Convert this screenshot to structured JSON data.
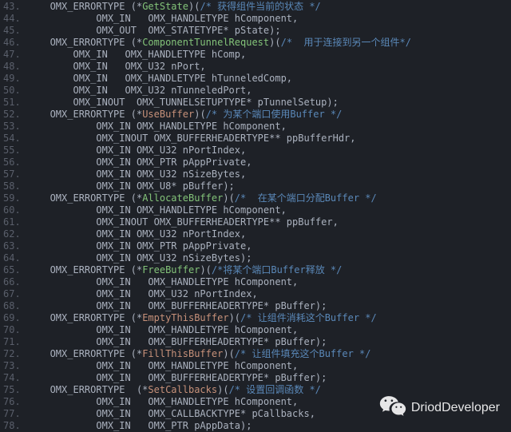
{
  "first_line_no": 43,
  "watermark": "DriodDeveloper",
  "lines": [
    [
      [
        "t",
        "    OMX_ERRORTYPE (*"
      ],
      [
        "fn",
        "GetState"
      ],
      [
        "t",
        ")("
      ],
      [
        "cm",
        "/* 获得组件当前的状态 */"
      ]
    ],
    [
      [
        "t",
        "            OMX_IN   OMX_HANDLETYPE hComponent,"
      ]
    ],
    [
      [
        "t",
        "            OMX_OUT  OMX_STATETYPE* pState);"
      ]
    ],
    [
      [
        "t",
        "    OMX_ERRORTYPE (*"
      ],
      [
        "fn",
        "ComponentTunnelRequest"
      ],
      [
        "t",
        ")("
      ],
      [
        "cm",
        "/*  用于连接到另一个组件*/"
      ]
    ],
    [
      [
        "t",
        "        OMX_IN   OMX_HANDLETYPE hComp,"
      ]
    ],
    [
      [
        "t",
        "        OMX_IN   OMX_U32 nPort,"
      ]
    ],
    [
      [
        "t",
        "        OMX_IN   OMX_HANDLETYPE hTunneledComp,"
      ]
    ],
    [
      [
        "t",
        "        OMX_IN   OMX_U32 nTunneledPort,"
      ]
    ],
    [
      [
        "t",
        "        OMX_INOUT  OMX_TUNNELSETUPTYPE* pTunnelSetup);"
      ]
    ],
    [
      [
        "t",
        "    OMX_ERRORTYPE (*"
      ],
      [
        "fn2",
        "UseBuffer"
      ],
      [
        "t",
        ")("
      ],
      [
        "cm",
        "/* 为某个端口使用Buffer */"
      ]
    ],
    [
      [
        "t",
        "            OMX_IN OMX_HANDLETYPE hComponent,"
      ]
    ],
    [
      [
        "t",
        "            OMX_INOUT OMX_BUFFERHEADERTYPE** ppBufferHdr,"
      ]
    ],
    [
      [
        "t",
        "            OMX_IN OMX_U32 nPortIndex,"
      ]
    ],
    [
      [
        "t",
        "            OMX_IN OMX_PTR pAppPrivate,"
      ]
    ],
    [
      [
        "t",
        "            OMX_IN OMX_U32 nSizeBytes,"
      ]
    ],
    [
      [
        "t",
        "            OMX_IN OMX_U8* pBuffer);"
      ]
    ],
    [
      [
        "t",
        "    OMX_ERRORTYPE (*"
      ],
      [
        "fn",
        "AllocateBuffer"
      ],
      [
        "t",
        ")("
      ],
      [
        "cm",
        "/*  在某个端口分配Buffer */"
      ]
    ],
    [
      [
        "t",
        "            OMX_IN OMX_HANDLETYPE hComponent,"
      ]
    ],
    [
      [
        "t",
        "            OMX_INOUT OMX_BUFFERHEADERTYPE** ppBuffer,"
      ]
    ],
    [
      [
        "t",
        "            OMX_IN OMX_U32 nPortIndex,"
      ]
    ],
    [
      [
        "t",
        "            OMX_IN OMX_PTR pAppPrivate,"
      ]
    ],
    [
      [
        "t",
        "            OMX_IN OMX_U32 nSizeBytes);"
      ]
    ],
    [
      [
        "t",
        "    OMX_ERRORTYPE (*"
      ],
      [
        "fn",
        "FreeBuffer"
      ],
      [
        "t",
        ")("
      ],
      [
        "cm",
        "/*将某个端口Buffer释放 */"
      ]
    ],
    [
      [
        "t",
        "            OMX_IN   OMX_HANDLETYPE hComponent,"
      ]
    ],
    [
      [
        "t",
        "            OMX_IN   OMX_U32 nPortIndex,"
      ]
    ],
    [
      [
        "t",
        "            OMX_IN   OMX_BUFFERHEADERTYPE* pBuffer);"
      ]
    ],
    [
      [
        "t",
        "    OMX_ERRORTYPE (*"
      ],
      [
        "fn2",
        "EmptyThisBuffer"
      ],
      [
        "t",
        ")("
      ],
      [
        "cm",
        "/* 让组件消耗这个Buffer */"
      ]
    ],
    [
      [
        "t",
        "            OMX_IN   OMX_HANDLETYPE hComponent,"
      ]
    ],
    [
      [
        "t",
        "            OMX_IN   OMX_BUFFERHEADERTYPE* pBuffer);"
      ]
    ],
    [
      [
        "t",
        "    OMX_ERRORTYPE (*"
      ],
      [
        "fn2",
        "FillThisBuffer"
      ],
      [
        "t",
        ")("
      ],
      [
        "cm",
        "/* 让组件填充这个Buffer */"
      ]
    ],
    [
      [
        "t",
        "            OMX_IN   OMX_HANDLETYPE hComponent,"
      ]
    ],
    [
      [
        "t",
        "            OMX_IN   OMX_BUFFERHEADERTYPE* pBuffer);"
      ]
    ],
    [
      [
        "t",
        "    OMX_ERRORTYPE  (*"
      ],
      [
        "fn2",
        "SetCallbacks"
      ],
      [
        "t",
        ")("
      ],
      [
        "cm",
        "/* 设置回调函数 */"
      ]
    ],
    [
      [
        "t",
        "            OMX_IN   OMX_HANDLETYPE hComponent,"
      ]
    ],
    [
      [
        "t",
        "            OMX_IN   OMX_CALLBACKTYPE* pCallbacks,"
      ]
    ],
    [
      [
        "t",
        "            OMX_IN   OMX_PTR pAppData);"
      ]
    ]
  ]
}
